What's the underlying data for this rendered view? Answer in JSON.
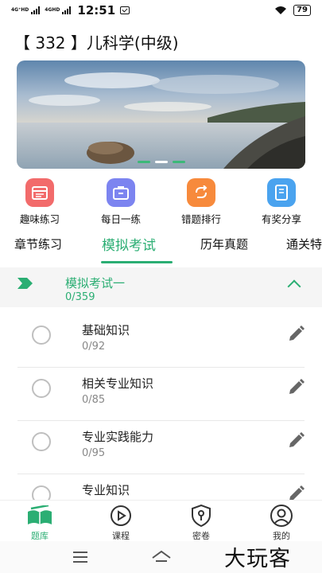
{
  "status_bar": {
    "sim1_label": "4G⁺HD",
    "sim2_label": "4GHD",
    "time": "12:51",
    "battery": "79"
  },
  "page": {
    "title": "【 332 】儿科学(中级)"
  },
  "banner": {
    "image_desc": "lake-landscape-photo",
    "slides": 3,
    "active_slide": 2
  },
  "quick_actions": [
    {
      "label": "趣味练习",
      "icon": "calendar-icon",
      "color": "#f26b6b"
    },
    {
      "label": "每日一练",
      "icon": "briefcase-icon",
      "color": "#7c84f0"
    },
    {
      "label": "错题排行",
      "icon": "refresh-icon",
      "color": "#f78a3c"
    },
    {
      "label": "有奖分享",
      "icon": "book-icon",
      "color": "#4aa3ef"
    }
  ],
  "tabs": [
    {
      "label": "章节练习",
      "active": false
    },
    {
      "label": "模拟考试",
      "active": true
    },
    {
      "label": "历年真题",
      "active": false
    },
    {
      "label": "通关特",
      "active": false
    }
  ],
  "section": {
    "title": "模拟考试一",
    "count": "0/359"
  },
  "items": [
    {
      "title": "基础知识",
      "count": "0/92"
    },
    {
      "title": "相关专业知识",
      "count": "0/85"
    },
    {
      "title": "专业实践能力",
      "count": "0/95"
    },
    {
      "title": "专业知识",
      "count": ""
    }
  ],
  "bottom_nav": [
    {
      "label": "题库",
      "active": true
    },
    {
      "label": "课程",
      "active": false
    },
    {
      "label": "密卷",
      "active": false
    },
    {
      "label": "我的",
      "active": false
    }
  ],
  "watermark": "大玩客",
  "colors": {
    "accent": "#2bae73",
    "section_bg": "#f5f5f5"
  }
}
